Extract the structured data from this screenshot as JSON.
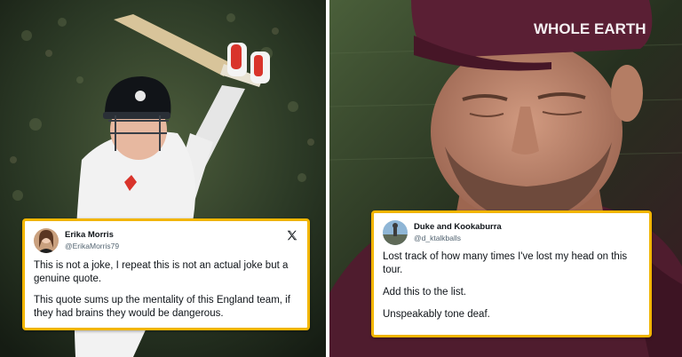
{
  "left_image": {
    "description_icon": "cricket-batsman-photo"
  },
  "right_image": {
    "cap_text": "WHOLE EARTH"
  },
  "tweet_left": {
    "display_name": "Erika Morris",
    "handle": "@ErikaMorris79",
    "icon": "x-logo-icon",
    "paragraphs": [
      "This is not a joke, I repeat this is not an actual joke but a genuine quote.",
      "This quote sums up the mentality of this England team, if they had brains they would be dangerous."
    ]
  },
  "tweet_right": {
    "display_name": "Duke and Kookaburra",
    "handle": "@d_ktalkballs",
    "paragraphs": [
      "Lost track of how many times I've lost my head on this tour.",
      "Add this to the list.",
      "Unspeakably tone deaf."
    ]
  },
  "colors": {
    "card_border": "#f2b500",
    "stadium_green": "#2f4a2c",
    "cap_maroon": "#5a1f34"
  }
}
